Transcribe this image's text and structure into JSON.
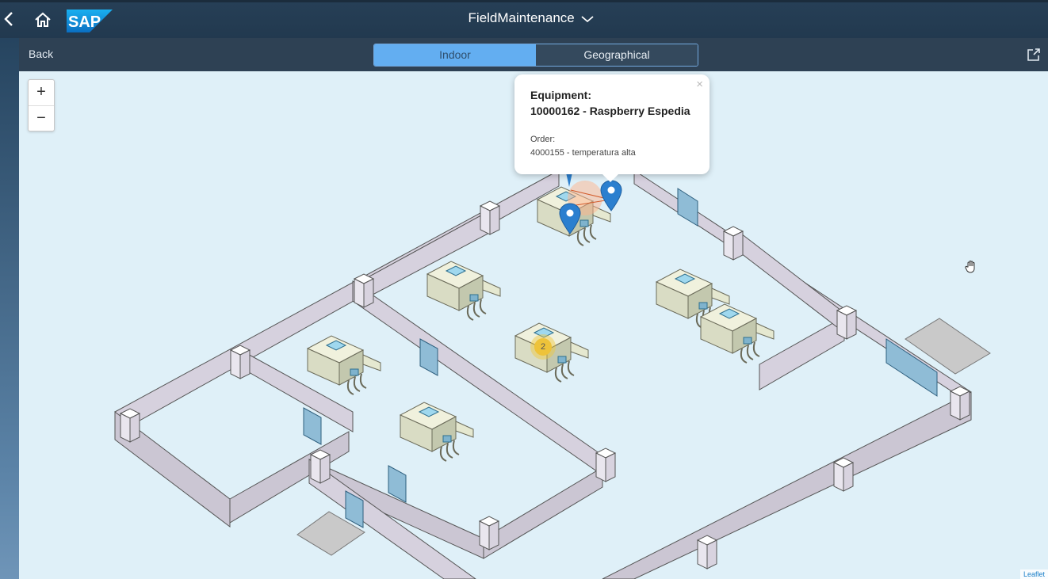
{
  "topbar": {
    "app_title": "FieldMaintenance",
    "logo_text": "SAP"
  },
  "subheader": {
    "back_label": "Back",
    "segments": [
      {
        "label": "Indoor",
        "selected": true
      },
      {
        "label": "Geographical",
        "selected": false
      }
    ]
  },
  "map": {
    "zoom_in": "+",
    "zoom_out": "−",
    "attribution": "Leaflet",
    "cluster_count": "2",
    "popup": {
      "equipment_label": "Equipment:",
      "equipment_value": "10000162 - Raspberry Espedia",
      "order_label": "Order:",
      "order_value": "4000155 - temperatura alta",
      "close": "×"
    }
  },
  "colors": {
    "accent": "#63aef1",
    "marker": "#2b7fcf",
    "cluster": "#eec33a",
    "wall": "#d6d1de",
    "map_bg": "#dff0f8"
  }
}
